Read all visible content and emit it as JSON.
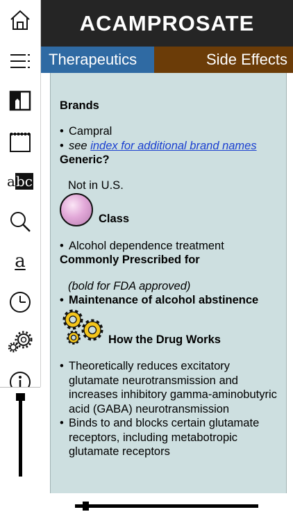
{
  "header": {
    "title": "ACAMPROSATE"
  },
  "tabs": [
    {
      "label": "Therapeutics",
      "color": "#2f6aa3"
    },
    {
      "label": "Side Effects",
      "color": "#6b3c08"
    }
  ],
  "sidebar": {
    "icons": [
      "home-icon",
      "menu-icon",
      "bookmark-book-icon",
      "notepad-icon",
      "abc-icon",
      "search-icon",
      "amazon-icon",
      "history-clock-icon",
      "settings-gears-icon",
      "info-icon"
    ],
    "abc_prefix": "a",
    "abc_highlight": "bc",
    "amazon_letter": "a"
  },
  "content": {
    "brands_heading": "Brands",
    "brands": [
      "Campral"
    ],
    "see_word": "see",
    "index_link": "index for additional brand names",
    "generic_heading": "Generic?",
    "generic_value": "Not in U.S.",
    "class_heading": "Class",
    "class_items": [
      "Alcohol dependence treatment"
    ],
    "prescribed_heading": "Commonly Prescribed for",
    "fda_note": "(bold for FDA approved)",
    "prescribed_items": [
      "Maintenance of alcohol abstinence"
    ],
    "works_heading": "How the Drug Works",
    "works_items": [
      "Theoretically reduces excitatory glutamate neurotransmission and increases inhibitory gamma-aminobutyric acid (GABA) neurotransmission",
      "Binds to and blocks certain glutamate receptors, including metabotropic glutamate receptors"
    ]
  }
}
